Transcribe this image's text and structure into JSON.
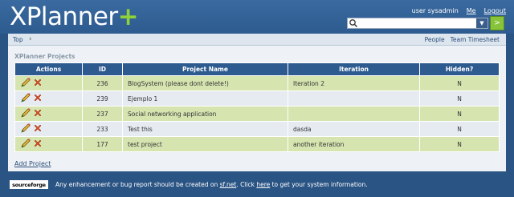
{
  "header": {
    "logo_main": "XPlanner",
    "logo_plus": "+",
    "user_label": "user sysadmin",
    "me_link": "Me",
    "logout_link": "Logout",
    "search_value": "",
    "go_label": ">"
  },
  "nav": {
    "breadcrumb": "Top",
    "people": "People",
    "team_timesheet": "Team Timesheet"
  },
  "main": {
    "section_title": "XPlanner Projects",
    "columns": [
      "Actions",
      "ID",
      "Project Name",
      "Iteration",
      "Hidden?"
    ],
    "rows": [
      {
        "id": "236",
        "name": "BlogSystem (please dont delete!)",
        "iteration": "Iteration 2",
        "hidden": "N"
      },
      {
        "id": "239",
        "name": "Ejemplo 1",
        "iteration": "",
        "hidden": "N"
      },
      {
        "id": "237",
        "name": "Social networking application",
        "iteration": "",
        "hidden": "N"
      },
      {
        "id": "233",
        "name": "Test this",
        "iteration": "dasda",
        "hidden": "N"
      },
      {
        "id": "177",
        "name": "test project",
        "iteration": "another iteration",
        "hidden": "N"
      }
    ],
    "add_project": "Add Project"
  },
  "footer": {
    "sf_logo": "sourceforge",
    "text1": "Any enhancement or bug report should be created on ",
    "sf_link": "sf.net",
    "text2": ". Click ",
    "here_link": "here",
    "text3": " to get your system information."
  },
  "colors": {
    "header_bg": "#2d5b8f",
    "row_odd": "#d6e4b0",
    "row_even": "#e6ebf2",
    "accent_green": "#8fd13a"
  },
  "icons": [
    "edit-icon",
    "delete-icon",
    "search-icon",
    "chevron-right-icon"
  ]
}
